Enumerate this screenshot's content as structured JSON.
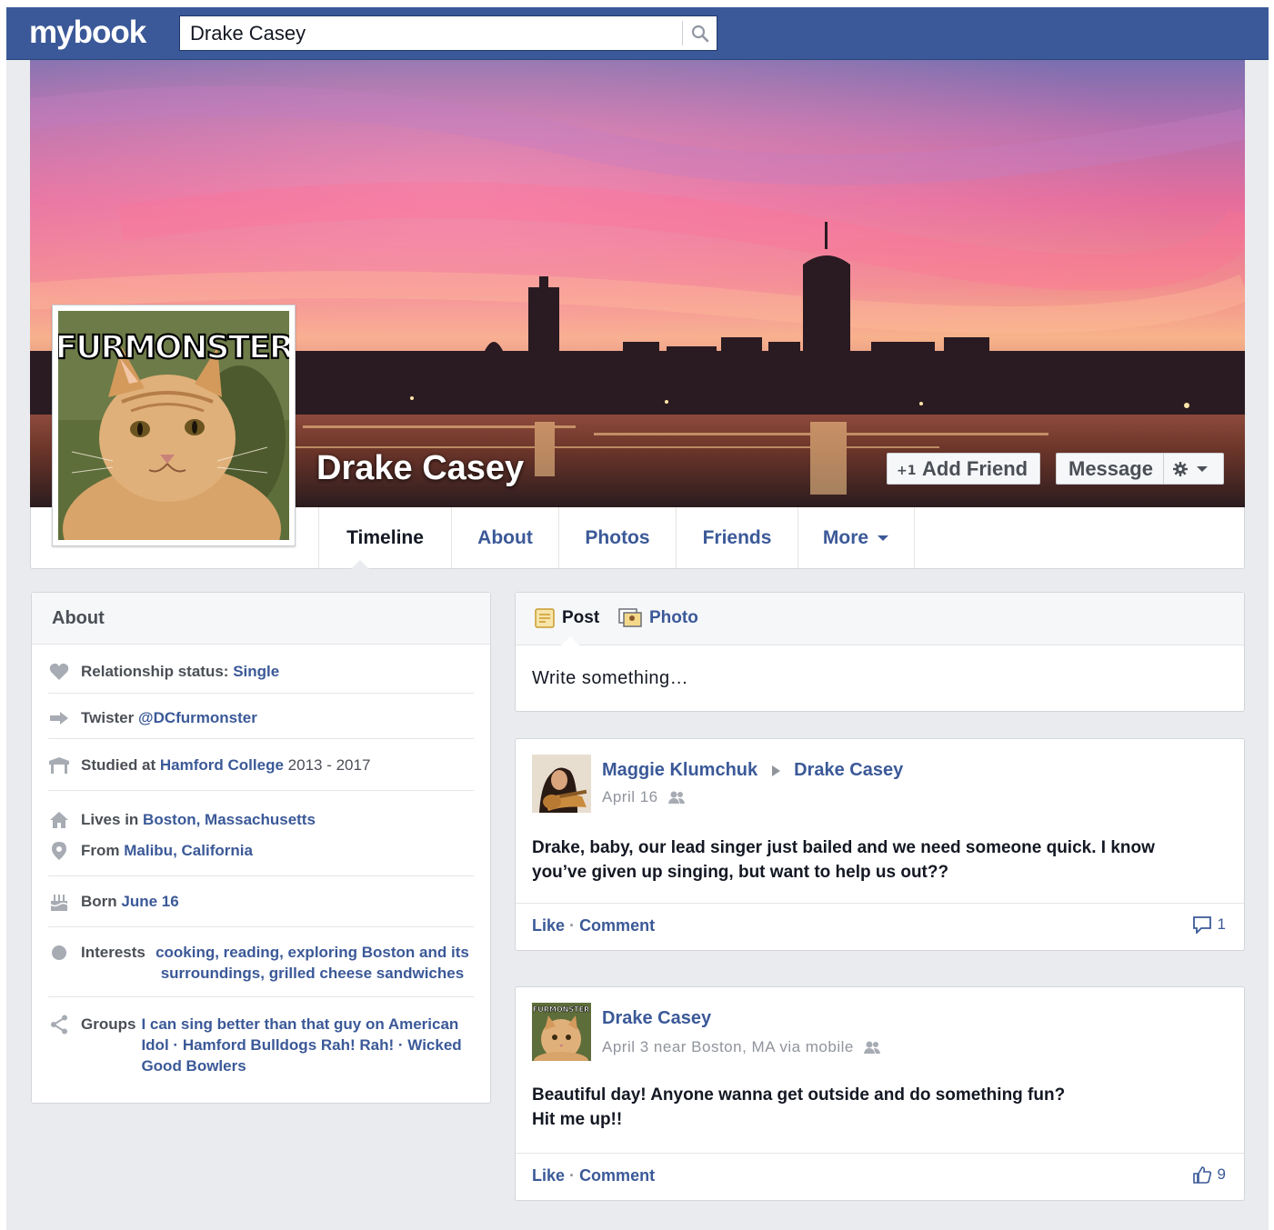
{
  "app": {
    "logo": "mybook"
  },
  "search": {
    "value": "Drake Casey"
  },
  "profile": {
    "name": "Drake Casey",
    "picture_caption": "FURMONSTER",
    "add_friend_label": "Add Friend",
    "message_label": "Message"
  },
  "tabs": {
    "timeline": "Timeline",
    "about": "About",
    "photos": "Photos",
    "friends": "Friends",
    "more": "More"
  },
  "about": {
    "title": "About",
    "relationship": {
      "label": "Relationship status:",
      "value": "Single"
    },
    "twitter": {
      "label": "Twister",
      "value": "@DCfurmonster"
    },
    "education": {
      "label": "Studied at",
      "school": "Hamford College",
      "years": "2013 - 2017"
    },
    "lives": {
      "label": "Lives in",
      "value": "Boston, Massachusetts"
    },
    "from": {
      "label": "From",
      "value": "Malibu, California"
    },
    "born": {
      "label": "Born",
      "value": "June 16"
    },
    "interests": {
      "label": "Interests",
      "value": "cooking, reading, exploring Boston and its surroundings, grilled cheese sandwiches"
    },
    "groups": {
      "label": "Groups",
      "items": [
        "I can sing better than that guy on American Idol",
        "Hamford Bulldogs Rah! Rah!",
        "Wicked Good Bowlers"
      ],
      "separator": "·"
    }
  },
  "composer": {
    "post_label": "Post",
    "photo_label": "Photo",
    "placeholder": "Write something…"
  },
  "posts": [
    {
      "author": "Maggie Klumchuk",
      "target": "Drake Casey",
      "meta": "April 16",
      "body": "Drake, baby, our lead singer just bailed and we need someone quick. I know you’ve given up singing, but want to help us out??",
      "like": "Like",
      "comment": "Comment",
      "separator": "·",
      "count": "1"
    },
    {
      "author": "Drake Casey",
      "avatar_caption": "FURMONSTER",
      "meta": "April 3 near Boston, MA via mobile",
      "body_line1": "Beautiful day! Anyone wanna get outside and do something fun?",
      "body_line2": "Hit me up!!",
      "like": "Like",
      "comment": "Comment",
      "separator": "·",
      "count": "9"
    }
  ],
  "colors": {
    "brand": "#3b5998",
    "page_background": "#e9ebee",
    "link": "#3b5998",
    "muted": "#90949c"
  }
}
